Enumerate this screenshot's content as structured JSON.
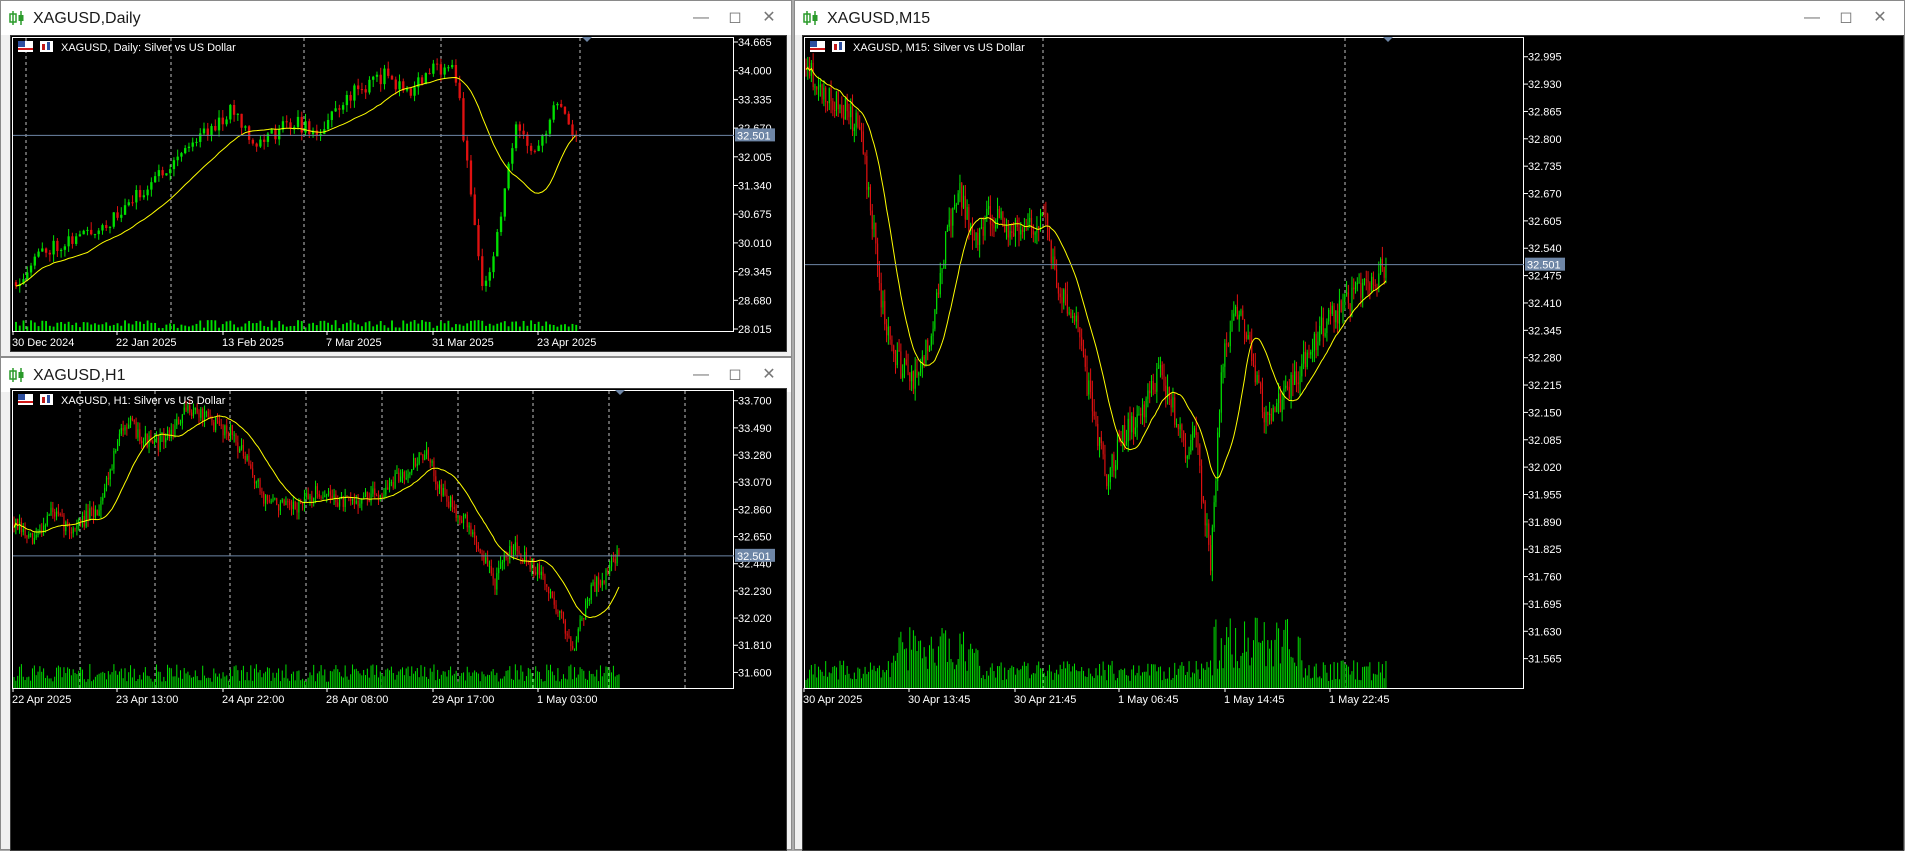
{
  "colors": {
    "up": "#00e000",
    "down": "#e01010",
    "ma": "#ffff00",
    "grid": "#bfbfbf",
    "axis": "#ffffff",
    "bg": "#000000",
    "price_line": "#6e86a6",
    "price_tag_bg": "#6e86a6",
    "volume": "#00e000",
    "tick_text": "#ffffff"
  },
  "windows": {
    "daily": {
      "title": "XAGUSD,Daily",
      "legend": "XAGUSD, Daily:  Silver vs US Dollar",
      "price_tag": "32.501",
      "chart_data": {
        "type": "candlestick",
        "symbol": "XAGUSD",
        "timeframe": "Daily",
        "y_ticks": [
          "34.665",
          "34.000",
          "33.335",
          "32.670",
          "32.005",
          "31.340",
          "30.675",
          "30.010",
          "29.345",
          "28.680",
          "28.015"
        ],
        "ylim": [
          28.015,
          34.665
        ],
        "x_labels": [
          "30 Dec 2024",
          "22 Jan 2025",
          "13 Feb 2025",
          "7 Mar 2025",
          "31 Mar 2025",
          "23 Apr 2025"
        ],
        "last_price": 32.501,
        "moving_average": true,
        "volume_histogram": true,
        "anchors": [
          [
            0,
            29.1
          ],
          [
            6,
            29.75
          ],
          [
            10,
            29.95
          ],
          [
            18,
            30.2
          ],
          [
            26,
            30.55
          ],
          [
            38,
            31.6
          ],
          [
            46,
            32.3
          ],
          [
            52,
            32.7
          ],
          [
            58,
            33.1
          ],
          [
            64,
            32.3
          ],
          [
            74,
            32.85
          ],
          [
            80,
            32.5
          ],
          [
            88,
            33.4
          ],
          [
            98,
            33.9
          ],
          [
            104,
            33.5
          ],
          [
            110,
            33.95
          ],
          [
            116,
            34.2
          ],
          [
            118,
            33.3
          ],
          [
            121,
            31.0
          ],
          [
            124,
            29.0
          ],
          [
            127,
            29.6
          ],
          [
            130,
            31.3
          ],
          [
            133,
            32.6
          ],
          [
            137,
            32.2
          ],
          [
            141,
            32.65
          ],
          [
            144,
            33.4
          ],
          [
            146,
            33.0
          ],
          [
            149,
            32.5
          ]
        ]
      }
    },
    "h1": {
      "title": "XAGUSD,H1",
      "legend": "XAGUSD, H1:  Silver vs US Dollar",
      "price_tag": "32.501",
      "chart_data": {
        "type": "candlestick",
        "symbol": "XAGUSD",
        "timeframe": "H1",
        "y_ticks": [
          "33.700",
          "33.490",
          "33.280",
          "33.070",
          "32.860",
          "32.650",
          "32.440",
          "32.230",
          "32.020",
          "31.810",
          "31.600"
        ],
        "ylim": [
          31.495,
          33.744
        ],
        "x_labels": [
          "22 Apr 2025",
          "23 Apr 13:00",
          "24 Apr 22:00",
          "28 Apr 08:00",
          "29 Apr 17:00",
          "1 May 03:00"
        ],
        "last_price": 32.501,
        "moving_average": true,
        "volume_histogram": true,
        "anchors": [
          [
            0,
            32.75
          ],
          [
            10,
            32.6
          ],
          [
            20,
            32.85
          ],
          [
            30,
            32.7
          ],
          [
            45,
            32.85
          ],
          [
            60,
            33.55
          ],
          [
            75,
            33.35
          ],
          [
            85,
            33.45
          ],
          [
            95,
            33.65
          ],
          [
            105,
            33.55
          ],
          [
            118,
            33.45
          ],
          [
            135,
            32.95
          ],
          [
            150,
            32.85
          ],
          [
            165,
            33.0
          ],
          [
            180,
            32.9
          ],
          [
            200,
            33.0
          ],
          [
            215,
            33.2
          ],
          [
            222,
            33.3
          ],
          [
            233,
            32.95
          ],
          [
            245,
            32.75
          ],
          [
            260,
            32.3
          ],
          [
            270,
            32.6
          ],
          [
            285,
            32.35
          ],
          [
            295,
            32.05
          ],
          [
            302,
            31.8
          ],
          [
            312,
            32.25
          ],
          [
            320,
            32.35
          ],
          [
            327,
            32.55
          ]
        ]
      }
    },
    "m15": {
      "title": "XAGUSD,M15",
      "legend": "XAGUSD, M15:  Silver vs US Dollar",
      "price_tag": "32.501",
      "chart_data": {
        "type": "candlestick",
        "symbol": "XAGUSD",
        "timeframe": "M15",
        "y_ticks": [
          "32.995",
          "32.930",
          "32.865",
          "32.800",
          "32.735",
          "32.670",
          "32.605",
          "32.540",
          "32.475",
          "32.410",
          "32.345",
          "32.280",
          "32.215",
          "32.150",
          "32.085",
          "32.020",
          "31.955",
          "31.890",
          "31.825",
          "31.760",
          "31.695",
          "31.630",
          "31.565"
        ],
        "ylim": [
          31.5,
          33.03
        ],
        "x_labels": [
          "30 Apr 2025",
          "30 Apr 13:45",
          "30 Apr 21:45",
          "1 May 06:45",
          "1 May 14:45",
          "1 May 22:45"
        ],
        "last_price": 32.501,
        "moving_average": true,
        "volume_histogram": true,
        "anchors": [
          [
            0,
            32.98
          ],
          [
            10,
            32.9
          ],
          [
            20,
            32.88
          ],
          [
            30,
            32.82
          ],
          [
            36,
            32.65
          ],
          [
            44,
            32.35
          ],
          [
            54,
            32.25
          ],
          [
            62,
            32.22
          ],
          [
            70,
            32.35
          ],
          [
            78,
            32.55
          ],
          [
            86,
            32.68
          ],
          [
            94,
            32.55
          ],
          [
            102,
            32.62
          ],
          [
            110,
            32.6
          ],
          [
            120,
            32.58
          ],
          [
            134,
            32.62
          ],
          [
            140,
            32.45
          ],
          [
            150,
            32.38
          ],
          [
            160,
            32.15
          ],
          [
            168,
            32.0
          ],
          [
            178,
            32.1
          ],
          [
            188,
            32.15
          ],
          [
            198,
            32.25
          ],
          [
            206,
            32.15
          ],
          [
            212,
            32.05
          ],
          [
            218,
            32.1
          ],
          [
            226,
            31.78
          ],
          [
            232,
            32.25
          ],
          [
            240,
            32.4
          ],
          [
            248,
            32.3
          ],
          [
            258,
            32.12
          ],
          [
            268,
            32.2
          ],
          [
            276,
            32.25
          ],
          [
            288,
            32.35
          ],
          [
            300,
            32.4
          ],
          [
            312,
            32.45
          ],
          [
            320,
            32.48
          ],
          [
            324,
            32.5
          ]
        ]
      }
    }
  }
}
